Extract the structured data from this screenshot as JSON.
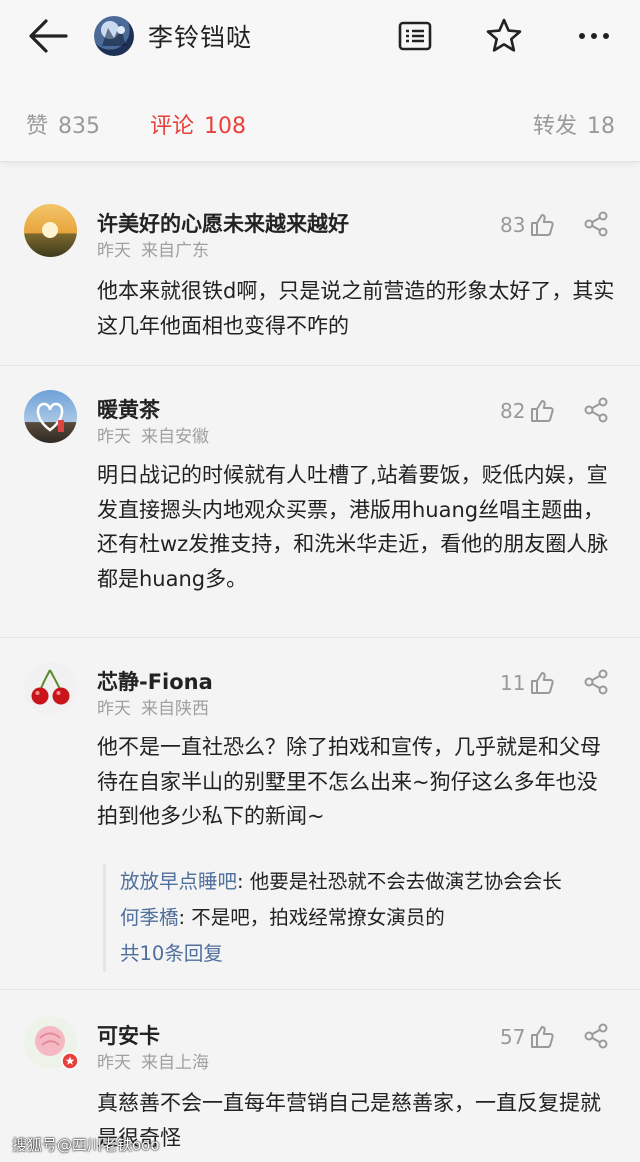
{
  "header": {
    "title": "李铃铛哒",
    "icons": [
      "back-arrow-icon",
      "avatar",
      "document-icon",
      "star-icon",
      "more-icon"
    ]
  },
  "stats": {
    "like_label": "赞",
    "like_count": "835",
    "comment_label": "评论",
    "comment_count": "108",
    "repost_label": "转发",
    "repost_count": "18",
    "active_color": "#e8413b"
  },
  "comments": [
    {
      "name": "许美好的心愿未来越来越好",
      "time": "昨天",
      "source": "来自广东",
      "likes": "83",
      "text": "他本来就很铁d啊，只是说之前营造的形象太好了，其实这几年他面相也变得不咋的"
    },
    {
      "name": "暖黄茶",
      "time": "昨天",
      "source": "来自安徽",
      "likes": "82",
      "text": "明日战记的时候就有人吐槽了,站着要饭，贬低内娱，宣发直接摁头内地观众买票，港版用huang丝唱主题曲，还有杜wz发推支持，和洗米华走近，看他的朋友圈人脉都是huang多。"
    },
    {
      "name": "芯静-Fiona",
      "time": "昨天",
      "source": "来自陕西",
      "likes": "11",
      "text": "他不是一直社恐么？除了拍戏和宣传，几乎就是和父母待在自家半山的别墅里不怎么出来~狗仔这么多年也没拍到他多少私下的新闻~",
      "replies": [
        {
          "who": "放放早点睡吧",
          "text": ": 他要是社恐就不会去做演艺协会会长"
        },
        {
          "who": "何季橋",
          "text": ": 不是吧，拍戏经常撩女演员的"
        }
      ],
      "more_replies": "共10条回复"
    },
    {
      "name": "可安卡",
      "time": "昨天",
      "source": "来自上海",
      "likes": "57",
      "text": "真慈善不会一直每年营销自己是慈善家，一直反复提就是很奇怪"
    }
  ],
  "watermark": "搜狐号@四川老铁ooo"
}
